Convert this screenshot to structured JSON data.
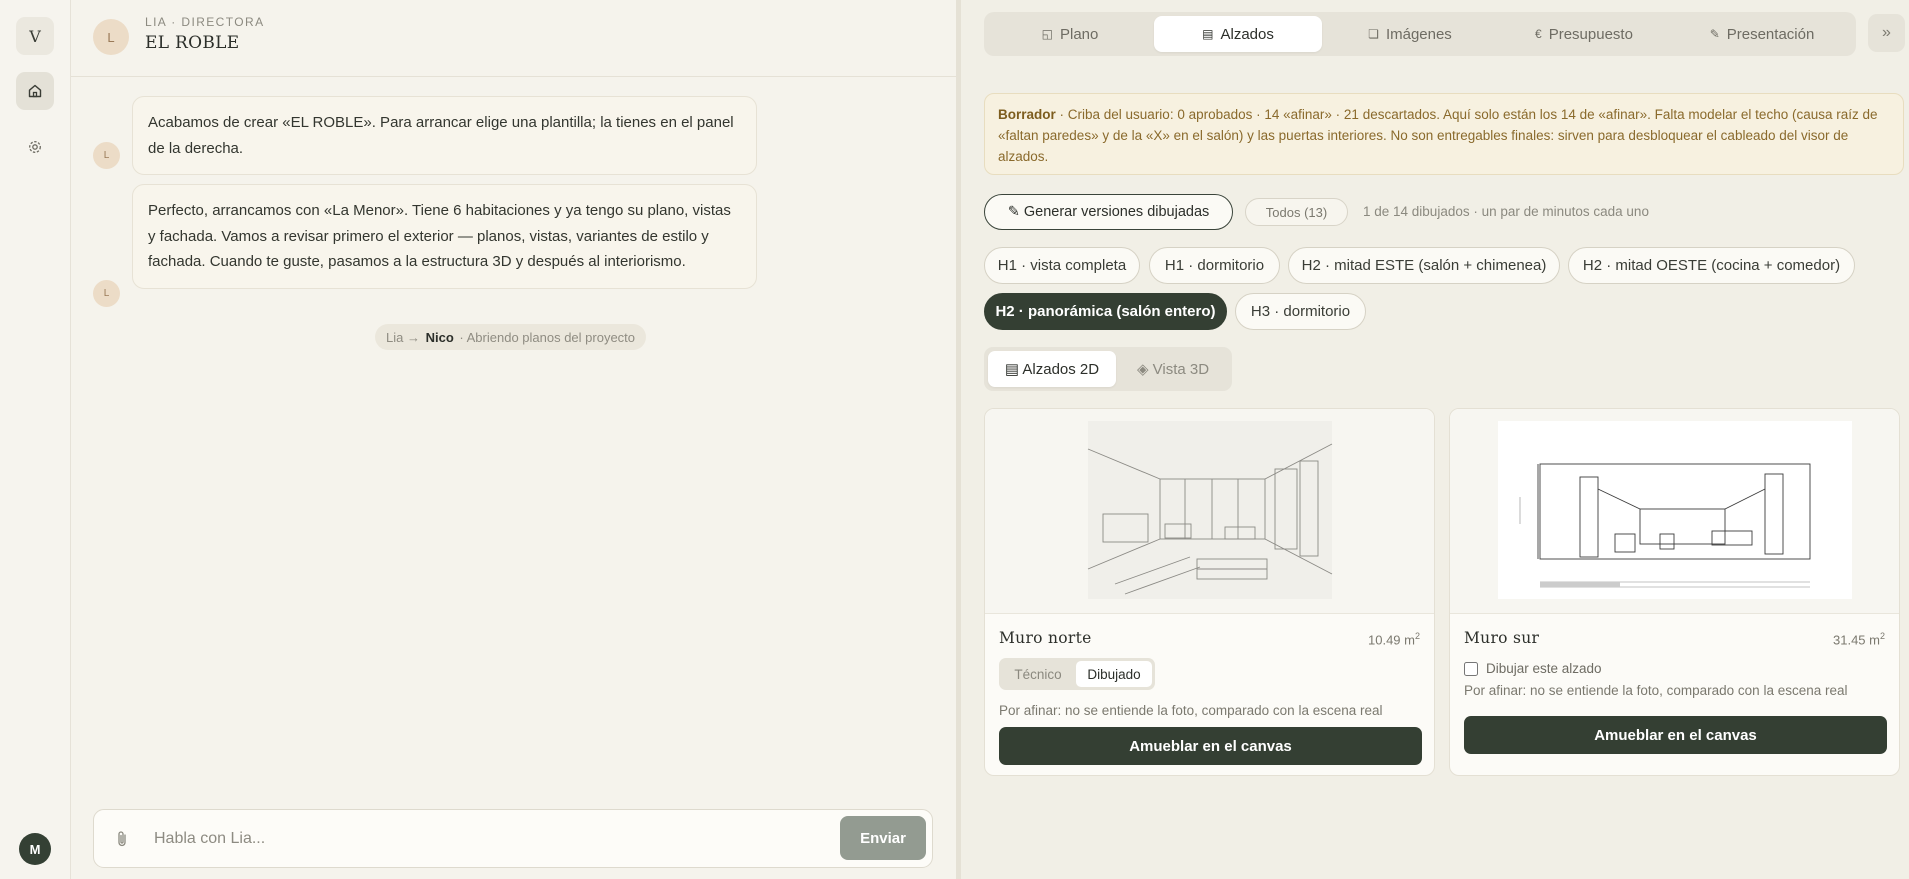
{
  "rail": {
    "logo_letter": "V",
    "avatar_letter": "M"
  },
  "chat": {
    "agent_initial": "L",
    "agent_role": "LIA · DIRECTORA",
    "project_title": "EL ROBLE",
    "messages": [
      {
        "author_initial": "L",
        "text": "Acabamos de crear «EL ROBLE». Para arrancar elige una plantilla; la tienes en el panel de la derecha."
      },
      {
        "author_initial": "L",
        "text": "Perfecto, arrancamos con «La Menor». Tiene 6 habitaciones y ya tengo su plano, vistas y fachada. Vamos a revisar primero el exterior — planos, vistas, variantes de estilo y fachada. Cuando te guste, pasamos a la estructura 3D y después al interiorismo."
      }
    ],
    "handoff": {
      "from": "Lia",
      "arrow": "→",
      "to": "Nico",
      "status": "· Abriendo planos del proyecto"
    },
    "composer": {
      "placeholder": "Habla con Lia...",
      "send_label": "Enviar"
    }
  },
  "panel": {
    "tabs": [
      {
        "icon": "◱",
        "label": "Plano",
        "active": false
      },
      {
        "icon": "▤",
        "label": "Alzados",
        "active": true
      },
      {
        "icon": "❏",
        "label": "Imágenes",
        "active": false
      },
      {
        "icon": "€",
        "label": "Presupuesto",
        "active": false
      },
      {
        "icon": "✎",
        "label": "Presentación",
        "active": false
      }
    ],
    "collapse_icon": "»",
    "notice": {
      "label": "Borrador",
      "text": " · Criba del usuario: 0 aprobados · 14 «afinar» · 21 descartados. Aquí solo están los 14 de «afinar». Falta modelar el techo (causa raíz de «faltan paredes» y de la «X» en el salón) y las puertas interiores. No son entregables finales: sirven para desbloquear el cableado del visor de alzados."
    },
    "generate_label": "✎ Generar versiones dibujadas",
    "all_label": "Todos (13)",
    "progress_text": "1 de 14 dibujados · un par de minutos cada uno",
    "chips": [
      {
        "label": "H1 · vista completa",
        "active": false
      },
      {
        "label": "H1 · dormitorio",
        "active": false
      },
      {
        "label": "H2 · mitad ESTE (salón + chimenea)",
        "active": false
      },
      {
        "label": "H2 · mitad OESTE (cocina + comedor)",
        "active": false
      },
      {
        "label": "H2 · panorámica (salón entero)",
        "active": true
      },
      {
        "label": "H3 · dormitorio",
        "active": false
      }
    ],
    "view_toggle": [
      {
        "label": "▤ Alzados 2D",
        "active": true
      },
      {
        "label": "◈ Vista 3D",
        "active": false
      }
    ],
    "cards": [
      {
        "title": "Muro norte",
        "area": "10.49 m",
        "area_unit_exp": "2",
        "toggle": [
          {
            "label": "Técnico",
            "active": false
          },
          {
            "label": "Dibujado",
            "active": true
          }
        ],
        "note": "Por afinar: no se entiende la foto, comparado con la escena real",
        "action_label": "Amueblar en el canvas"
      },
      {
        "title": "Muro sur",
        "area": "31.45 m",
        "area_unit_exp": "2",
        "checkbox_label": "Dibujar este alzado",
        "checkbox_checked": false,
        "note": "Por afinar: no se entiende la foto, comparado con la escena real",
        "action_label": "Amueblar en el canvas"
      }
    ]
  },
  "colors": {
    "accent_dark": "#343f33",
    "notice_bg": "#f7f1e0",
    "notice_text": "#8a6a2c",
    "agent_avatar": "#ecdcc7"
  }
}
